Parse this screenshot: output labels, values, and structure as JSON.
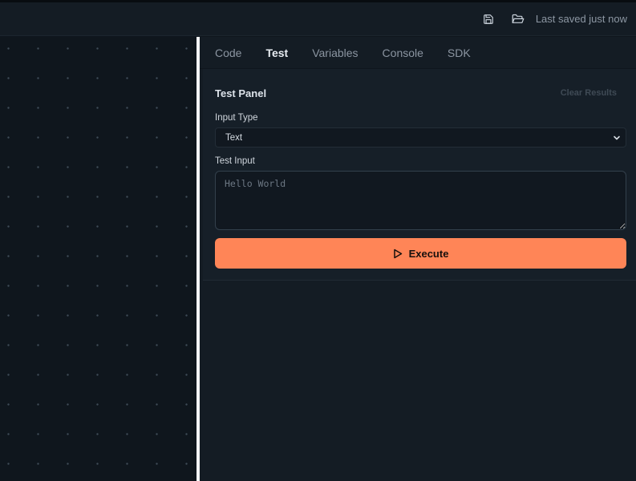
{
  "header": {
    "save_icon": "save-icon",
    "folder_icon": "folder-open-icon",
    "last_saved": "Last saved just now"
  },
  "panel": {
    "tabs": [
      {
        "label": "Code",
        "active": false
      },
      {
        "label": "Test",
        "active": true
      },
      {
        "label": "Variables",
        "active": false
      },
      {
        "label": "Console",
        "active": false
      },
      {
        "label": "SDK",
        "active": false
      }
    ],
    "test": {
      "title": "Test Panel",
      "clear_label": "Clear Results",
      "input_type_label": "Input Type",
      "input_type_value": "Text",
      "test_input_label": "Test Input",
      "test_input_placeholder": "Hello World",
      "test_input_value": "",
      "execute_label": "Execute",
      "execute_icon": "play-icon"
    }
  },
  "colors": {
    "accent": "#ff8557",
    "background": "#0f161d",
    "panel": "#141c24",
    "splitter": "#f2f4f6"
  }
}
